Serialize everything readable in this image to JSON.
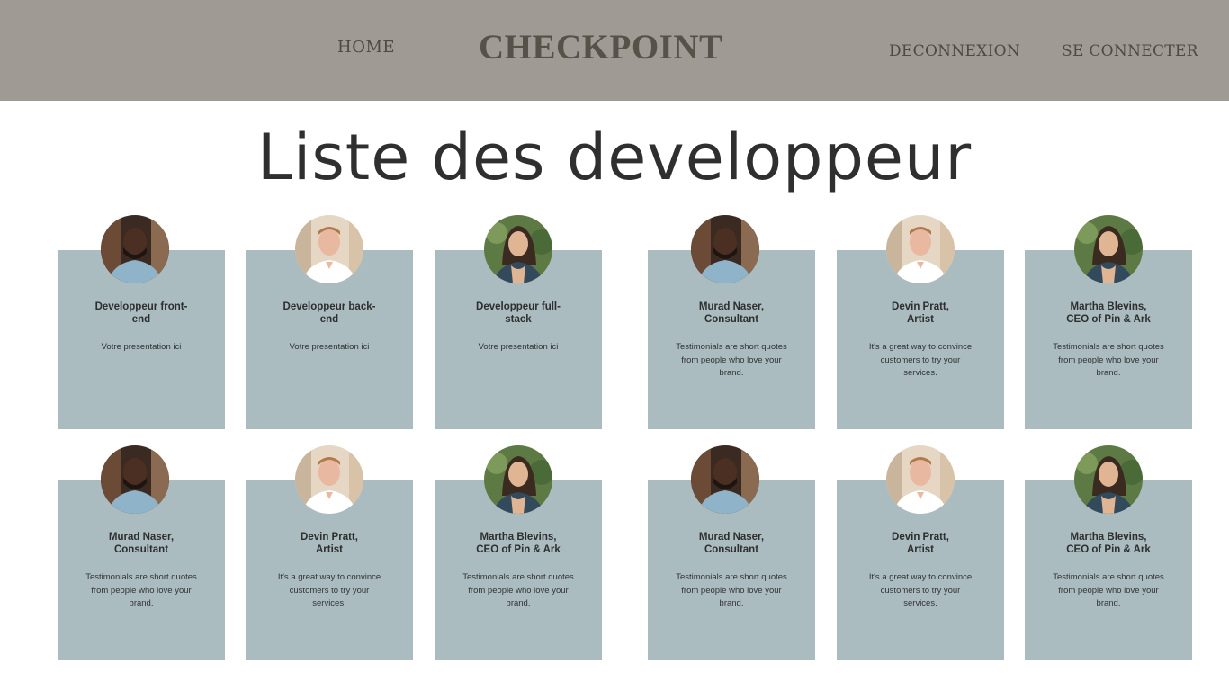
{
  "header": {
    "home_label": "HOME",
    "brand": "CHECKPOINT",
    "logout_label": "DECONNEXION",
    "login_label": "SE CONNECTER"
  },
  "main": {
    "title": "Liste des developpeur"
  },
  "colors": {
    "header_bg": "#9f9a93",
    "card_bg": "#aabcc0",
    "brand_text": "#575247"
  },
  "cards": [
    {
      "name": "Developpeur front-\nend",
      "text": "Votre presentation ici",
      "avatar": "man-dark-avatar"
    },
    {
      "name": "Developpeur back-\nend",
      "text": "Votre presentation ici",
      "avatar": "man-light-avatar"
    },
    {
      "name": "Developpeur full-\nstack",
      "text": "Votre presentation ici",
      "avatar": "woman-avatar"
    },
    {
      "name": "Murad Naser,\nConsultant",
      "text": "Testimonials are short quotes from people who love your brand.",
      "avatar": "man-dark-avatar"
    },
    {
      "name": "Devin Pratt,\nArtist",
      "text": "It's a great way to convince customers to try your services.",
      "avatar": "man-light-avatar"
    },
    {
      "name": "Martha Blevins,\nCEO of Pin & Ark",
      "text": "Testimonials are short quotes from people who love your brand.",
      "avatar": "woman-avatar"
    },
    {
      "name": "Murad Naser,\nConsultant",
      "text": "Testimonials are short quotes from people who love your brand.",
      "avatar": "man-dark-avatar"
    },
    {
      "name": "Devin Pratt,\nArtist",
      "text": "It's a great way to convince customers to try your services.",
      "avatar": "man-light-avatar"
    },
    {
      "name": "Martha Blevins,\nCEO of Pin & Ark",
      "text": "Testimonials are short quotes from people who love your brand.",
      "avatar": "woman-avatar"
    },
    {
      "name": "Murad Naser,\nConsultant",
      "text": "Testimonials are short quotes from people who love your brand.",
      "avatar": "man-dark-avatar"
    },
    {
      "name": "Devin Pratt,\nArtist",
      "text": "It's a great way to convince customers to try your services.",
      "avatar": "man-light-avatar"
    },
    {
      "name": "Martha Blevins,\nCEO of Pin & Ark",
      "text": "Testimonials are short quotes from people who love your brand.",
      "avatar": "woman-avatar"
    }
  ]
}
